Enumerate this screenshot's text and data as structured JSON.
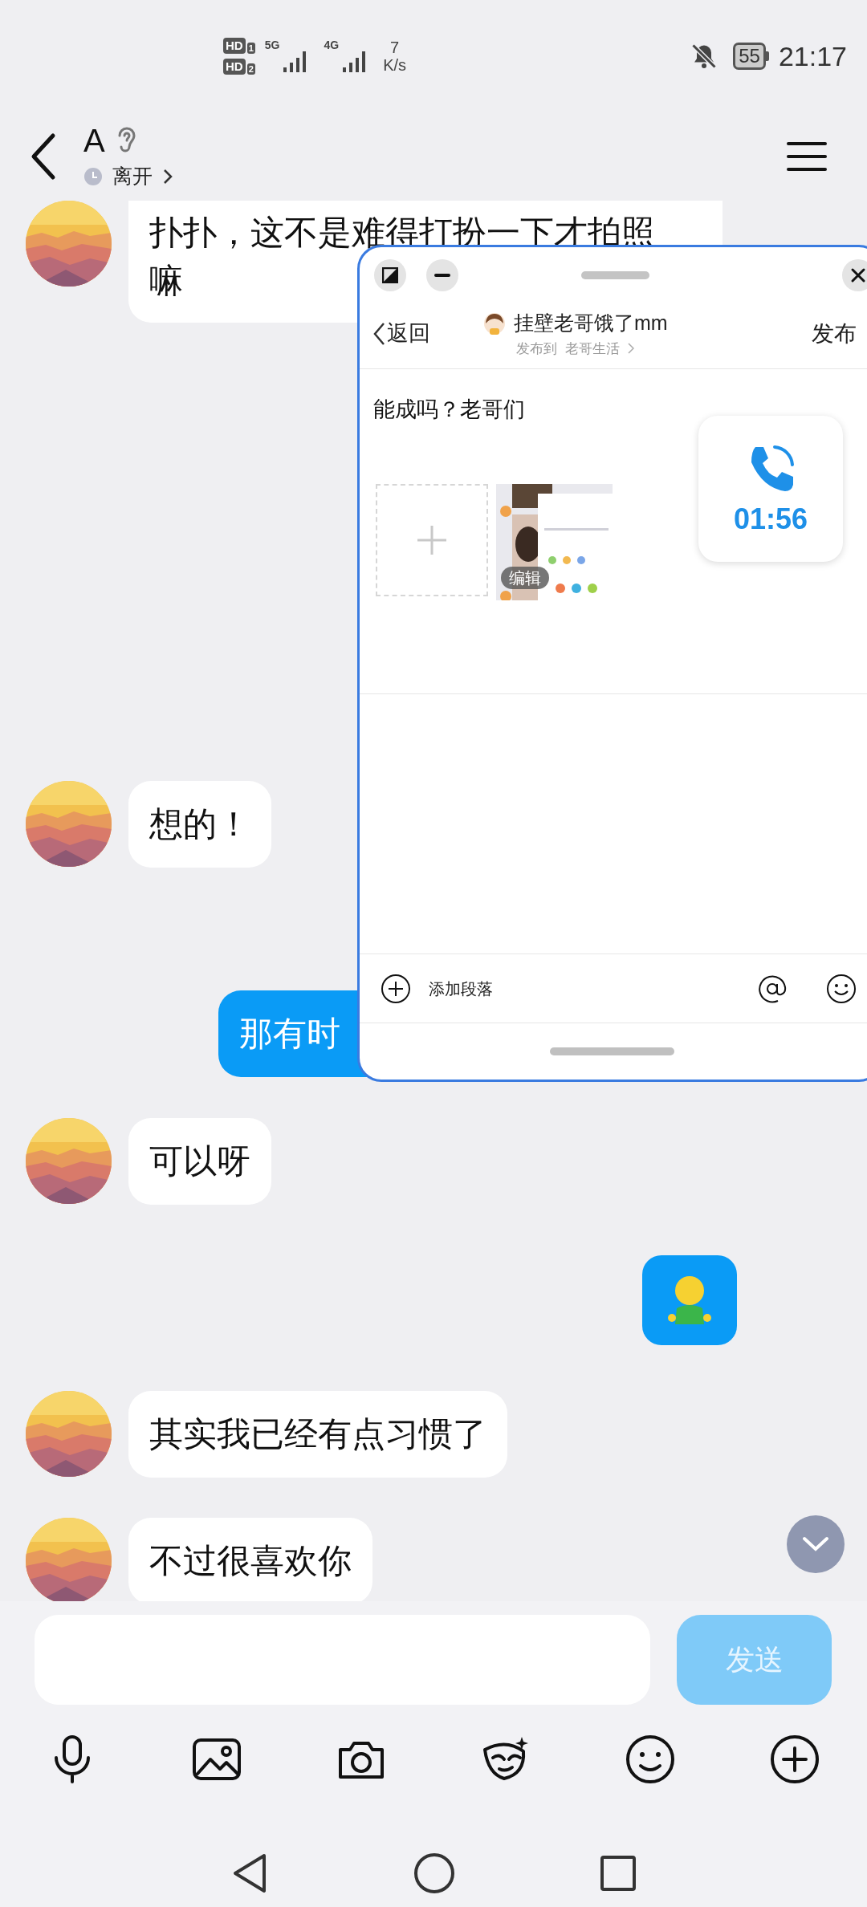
{
  "status_bar": {
    "sims": [
      {
        "label": "HD",
        "slot": "1"
      },
      {
        "label": "HD",
        "slot": "2"
      }
    ],
    "networks": [
      {
        "label": "5G"
      },
      {
        "label": "4G"
      }
    ],
    "speed_value": "7",
    "speed_unit": "K/s",
    "battery": "55",
    "time": "21:17"
  },
  "header": {
    "name": "A",
    "status": "离开"
  },
  "messages": [
    {
      "outgoing": false,
      "kind": "text",
      "lines": [
        "扑扑，这不是难得打扮一下才拍照",
        "嘛"
      ]
    },
    {
      "outgoing": false,
      "kind": "text",
      "lines": [
        "想的！"
      ]
    },
    {
      "outgoing": true,
      "kind": "text",
      "lines": [
        "那有时"
      ]
    },
    {
      "outgoing": false,
      "kind": "text",
      "lines": [
        "可以呀"
      ]
    },
    {
      "outgoing": true,
      "kind": "sticker"
    },
    {
      "outgoing": false,
      "kind": "text",
      "lines": [
        "其实我已经有点习惯了"
      ]
    },
    {
      "outgoing": false,
      "kind": "text",
      "lines": [
        "不过很喜欢你"
      ]
    }
  ],
  "composer": {
    "send": "发送",
    "send_enabled": false
  },
  "post_window": {
    "back": "返回",
    "author": "挂壁老哥饿了mm",
    "target_prefix": "发布到",
    "target": "老哥生活",
    "publish": "发布",
    "body": "能成吗？老哥们",
    "image_edit": "编辑",
    "add_paragraph": "添加段落",
    "call_timer": "01:56"
  }
}
